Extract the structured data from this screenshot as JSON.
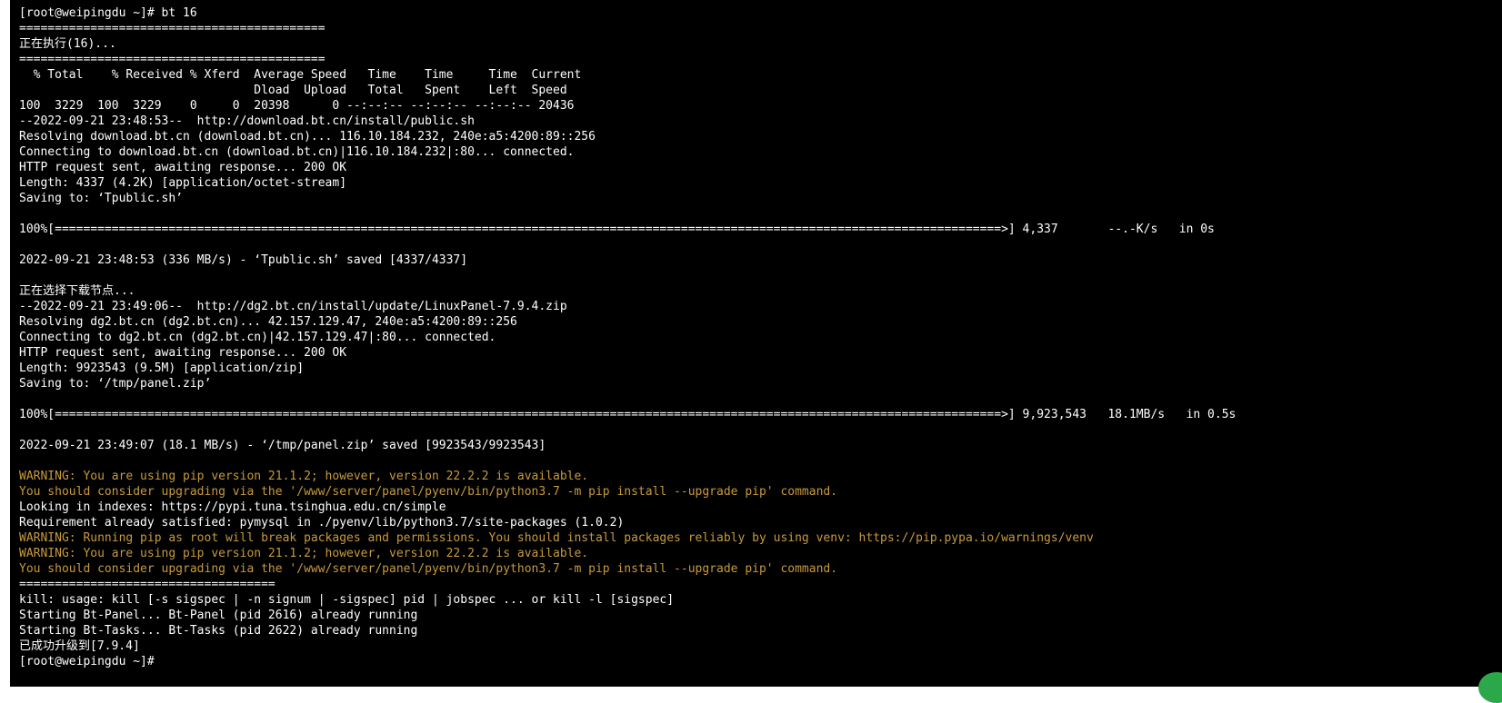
{
  "terminal": {
    "colors": {
      "background": "#000000",
      "text": "#ffffff",
      "warning": "#c79a3c"
    },
    "lines": [
      {
        "text": "[root@weipingdu ~]# bt 16",
        "kind": "normal"
      },
      {
        "text": "===========================================",
        "kind": "normal"
      },
      {
        "text": "正在执行(16)...",
        "kind": "normal"
      },
      {
        "text": "===========================================",
        "kind": "normal"
      },
      {
        "text": "  % Total    % Received % Xferd  Average Speed   Time    Time     Time  Current",
        "kind": "normal"
      },
      {
        "text": "                                 Dload  Upload   Total   Spent    Left  Speed",
        "kind": "normal"
      },
      {
        "text": "100  3229  100  3229    0     0  20398      0 --:--:-- --:--:-- --:--:-- 20436",
        "kind": "normal"
      },
      {
        "text": "--2022-09-21 23:48:53--  http://download.bt.cn/install/public.sh",
        "kind": "normal"
      },
      {
        "text": "Resolving download.bt.cn (download.bt.cn)... 116.10.184.232, 240e:a5:4200:89::256",
        "kind": "normal"
      },
      {
        "text": "Connecting to download.bt.cn (download.bt.cn)|116.10.184.232|:80... connected.",
        "kind": "normal"
      },
      {
        "text": "HTTP request sent, awaiting response... 200 OK",
        "kind": "normal"
      },
      {
        "text": "Length: 4337 (4.2K) [application/octet-stream]",
        "kind": "normal"
      },
      {
        "text": "Saving to: ‘Tpublic.sh’",
        "kind": "normal"
      },
      {
        "text": "",
        "kind": "normal"
      },
      {
        "text": "100%[=====================================================================================================================================>] 4,337       --.-K/s   in 0s",
        "kind": "normal"
      },
      {
        "text": "",
        "kind": "normal"
      },
      {
        "text": "2022-09-21 23:48:53 (336 MB/s) - ‘Tpublic.sh’ saved [4337/4337]",
        "kind": "normal"
      },
      {
        "text": "",
        "kind": "normal"
      },
      {
        "text": "正在选择下载节点...",
        "kind": "normal"
      },
      {
        "text": "--2022-09-21 23:49:06--  http://dg2.bt.cn/install/update/LinuxPanel-7.9.4.zip",
        "kind": "normal"
      },
      {
        "text": "Resolving dg2.bt.cn (dg2.bt.cn)... 42.157.129.47, 240e:a5:4200:89::256",
        "kind": "normal"
      },
      {
        "text": "Connecting to dg2.bt.cn (dg2.bt.cn)|42.157.129.47|:80... connected.",
        "kind": "normal"
      },
      {
        "text": "HTTP request sent, awaiting response... 200 OK",
        "kind": "normal"
      },
      {
        "text": "Length: 9923543 (9.5M) [application/zip]",
        "kind": "normal"
      },
      {
        "text": "Saving to: ‘/tmp/panel.zip’",
        "kind": "normal"
      },
      {
        "text": "",
        "kind": "normal"
      },
      {
        "text": "100%[=====================================================================================================================================>] 9,923,543   18.1MB/s   in 0.5s",
        "kind": "normal"
      },
      {
        "text": "",
        "kind": "normal"
      },
      {
        "text": "2022-09-21 23:49:07 (18.1 MB/s) - ‘/tmp/panel.zip’ saved [9923543/9923543]",
        "kind": "normal"
      },
      {
        "text": "",
        "kind": "normal"
      },
      {
        "text": "WARNING: You are using pip version 21.1.2; however, version 22.2.2 is available.",
        "kind": "warn"
      },
      {
        "text": "You should consider upgrading via the '/www/server/panel/pyenv/bin/python3.7 -m pip install --upgrade pip' command.",
        "kind": "warn"
      },
      {
        "text": "Looking in indexes: https://pypi.tuna.tsinghua.edu.cn/simple",
        "kind": "normal"
      },
      {
        "text": "Requirement already satisfied: pymysql in ./pyenv/lib/python3.7/site-packages (1.0.2)",
        "kind": "normal"
      },
      {
        "text": "WARNING: Running pip as root will break packages and permissions. You should install packages reliably by using venv: https://pip.pypa.io/warnings/venv",
        "kind": "warn"
      },
      {
        "text": "WARNING: You are using pip version 21.1.2; however, version 22.2.2 is available.",
        "kind": "warn"
      },
      {
        "text": "You should consider upgrading via the '/www/server/panel/pyenv/bin/python3.7 -m pip install --upgrade pip' command.",
        "kind": "warn"
      },
      {
        "text": "====================================",
        "kind": "normal"
      },
      {
        "text": "kill: usage: kill [-s sigspec | -n signum | -sigspec] pid | jobspec ... or kill -l [sigspec]",
        "kind": "normal"
      },
      {
        "text": "Starting Bt-Panel... Bt-Panel (pid 2616) already running",
        "kind": "normal"
      },
      {
        "text": "Starting Bt-Tasks... Bt-Tasks (pid 2622) already running",
        "kind": "normal"
      },
      {
        "text": "已成功升级到[7.9.4]",
        "kind": "normal"
      },
      {
        "text": "[root@weipingdu ~]#",
        "kind": "normal"
      }
    ]
  }
}
